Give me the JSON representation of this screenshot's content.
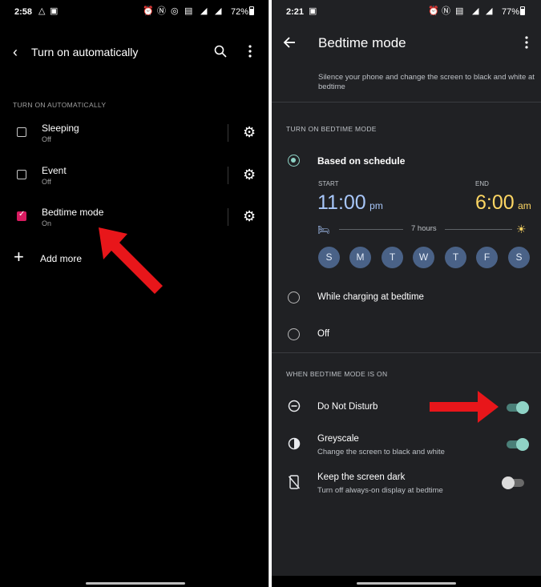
{
  "left": {
    "status": {
      "time": "2:58",
      "battery": "72%"
    },
    "header": {
      "title": "Turn on automatically"
    },
    "section_label": "TURN ON AUTOMATICALLY",
    "items": [
      {
        "title": "Sleeping",
        "subtitle": "Off",
        "checked": false
      },
      {
        "title": "Event",
        "subtitle": "Off",
        "checked": false
      },
      {
        "title": "Bedtime mode",
        "subtitle": "On",
        "checked": true
      }
    ],
    "add_more": "Add more",
    "arrow_color": "#e8161a"
  },
  "right": {
    "status": {
      "time": "2:21",
      "battery": "77%"
    },
    "header": {
      "title": "Bedtime mode"
    },
    "description": "Silence your phone and change the screen to black and white at bedtime",
    "section_turn_on": "TURN ON BEDTIME MODE",
    "schedule": {
      "label": "Based on schedule",
      "start_label": "START",
      "end_label": "END",
      "start_time": "11:00",
      "start_ampm": "pm",
      "end_time": "6:00",
      "end_ampm": "am",
      "duration": "7 hours",
      "days": [
        "S",
        "M",
        "T",
        "W",
        "T",
        "F",
        "S"
      ]
    },
    "option_charging": "While charging at bedtime",
    "option_off": "Off",
    "section_when": "WHEN BEDTIME MODE IS ON",
    "settings": [
      {
        "title": "Do Not Disturb",
        "subtitle": "",
        "on": true
      },
      {
        "title": "Greyscale",
        "subtitle": "Change the screen to black and white",
        "on": true
      },
      {
        "title": "Keep the screen dark",
        "subtitle": "Turn off always-on display at bedtime",
        "on": false
      }
    ],
    "colors": {
      "accent": "#8fd3c6",
      "start_time": "#a8c7fa",
      "end_time": "#fdd663",
      "day_chip": "#4a6287"
    }
  }
}
